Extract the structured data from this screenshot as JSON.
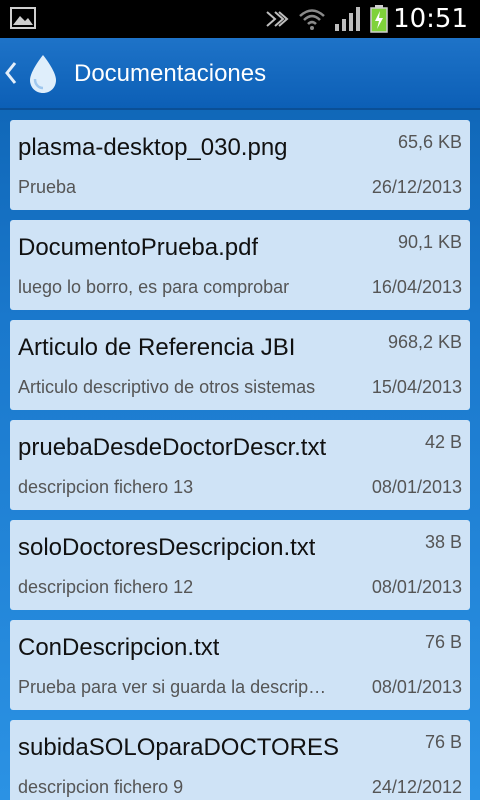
{
  "status_bar": {
    "time": "10:51",
    "icons": [
      "gallery-icon",
      "bluetooth-off-icon",
      "wifi-icon",
      "signal-icon",
      "battery-charging-icon"
    ],
    "battery_color": "#7fd23a"
  },
  "action_bar": {
    "title": "Documentaciones",
    "icons": [
      "back-chevron-icon",
      "water-drop-icon"
    ]
  },
  "documents": [
    {
      "name": "plasma-desktop_030.png",
      "size": "65,6 KB",
      "description": "Prueba",
      "date": "26/12/2013"
    },
    {
      "name": "DocumentoPrueba.pdf",
      "size": "90,1 KB",
      "description": "luego lo borro, es para comprobar",
      "date": "16/04/2013"
    },
    {
      "name": "Articulo de Referencia JBI",
      "size": "968,2 KB",
      "description": "Articulo descriptivo de otros sistemas",
      "date": "15/04/2013"
    },
    {
      "name": "pruebaDesdeDoctorDescr.txt",
      "size": "42 B",
      "description": "descripcion fichero 13",
      "date": "08/01/2013"
    },
    {
      "name": "soloDoctoresDescripcion.txt",
      "size": "38 B",
      "description": "descripcion fichero 12",
      "date": "08/01/2013"
    },
    {
      "name": "ConDescripcion.txt",
      "size": "76 B",
      "description": "Prueba para ver si guarda la descripcion",
      "date": "08/01/2013"
    },
    {
      "name": "subidaSOLOparaDOCTORES",
      "size": "76 B",
      "description": "descripcion fichero 9",
      "date": "24/12/2012"
    }
  ],
  "colors": {
    "action_bar": "#1565c0",
    "card_background": "#cfe3f6",
    "background_gradient_top": "#0b5fae",
    "background_gradient_bottom": "#2b92e4"
  }
}
